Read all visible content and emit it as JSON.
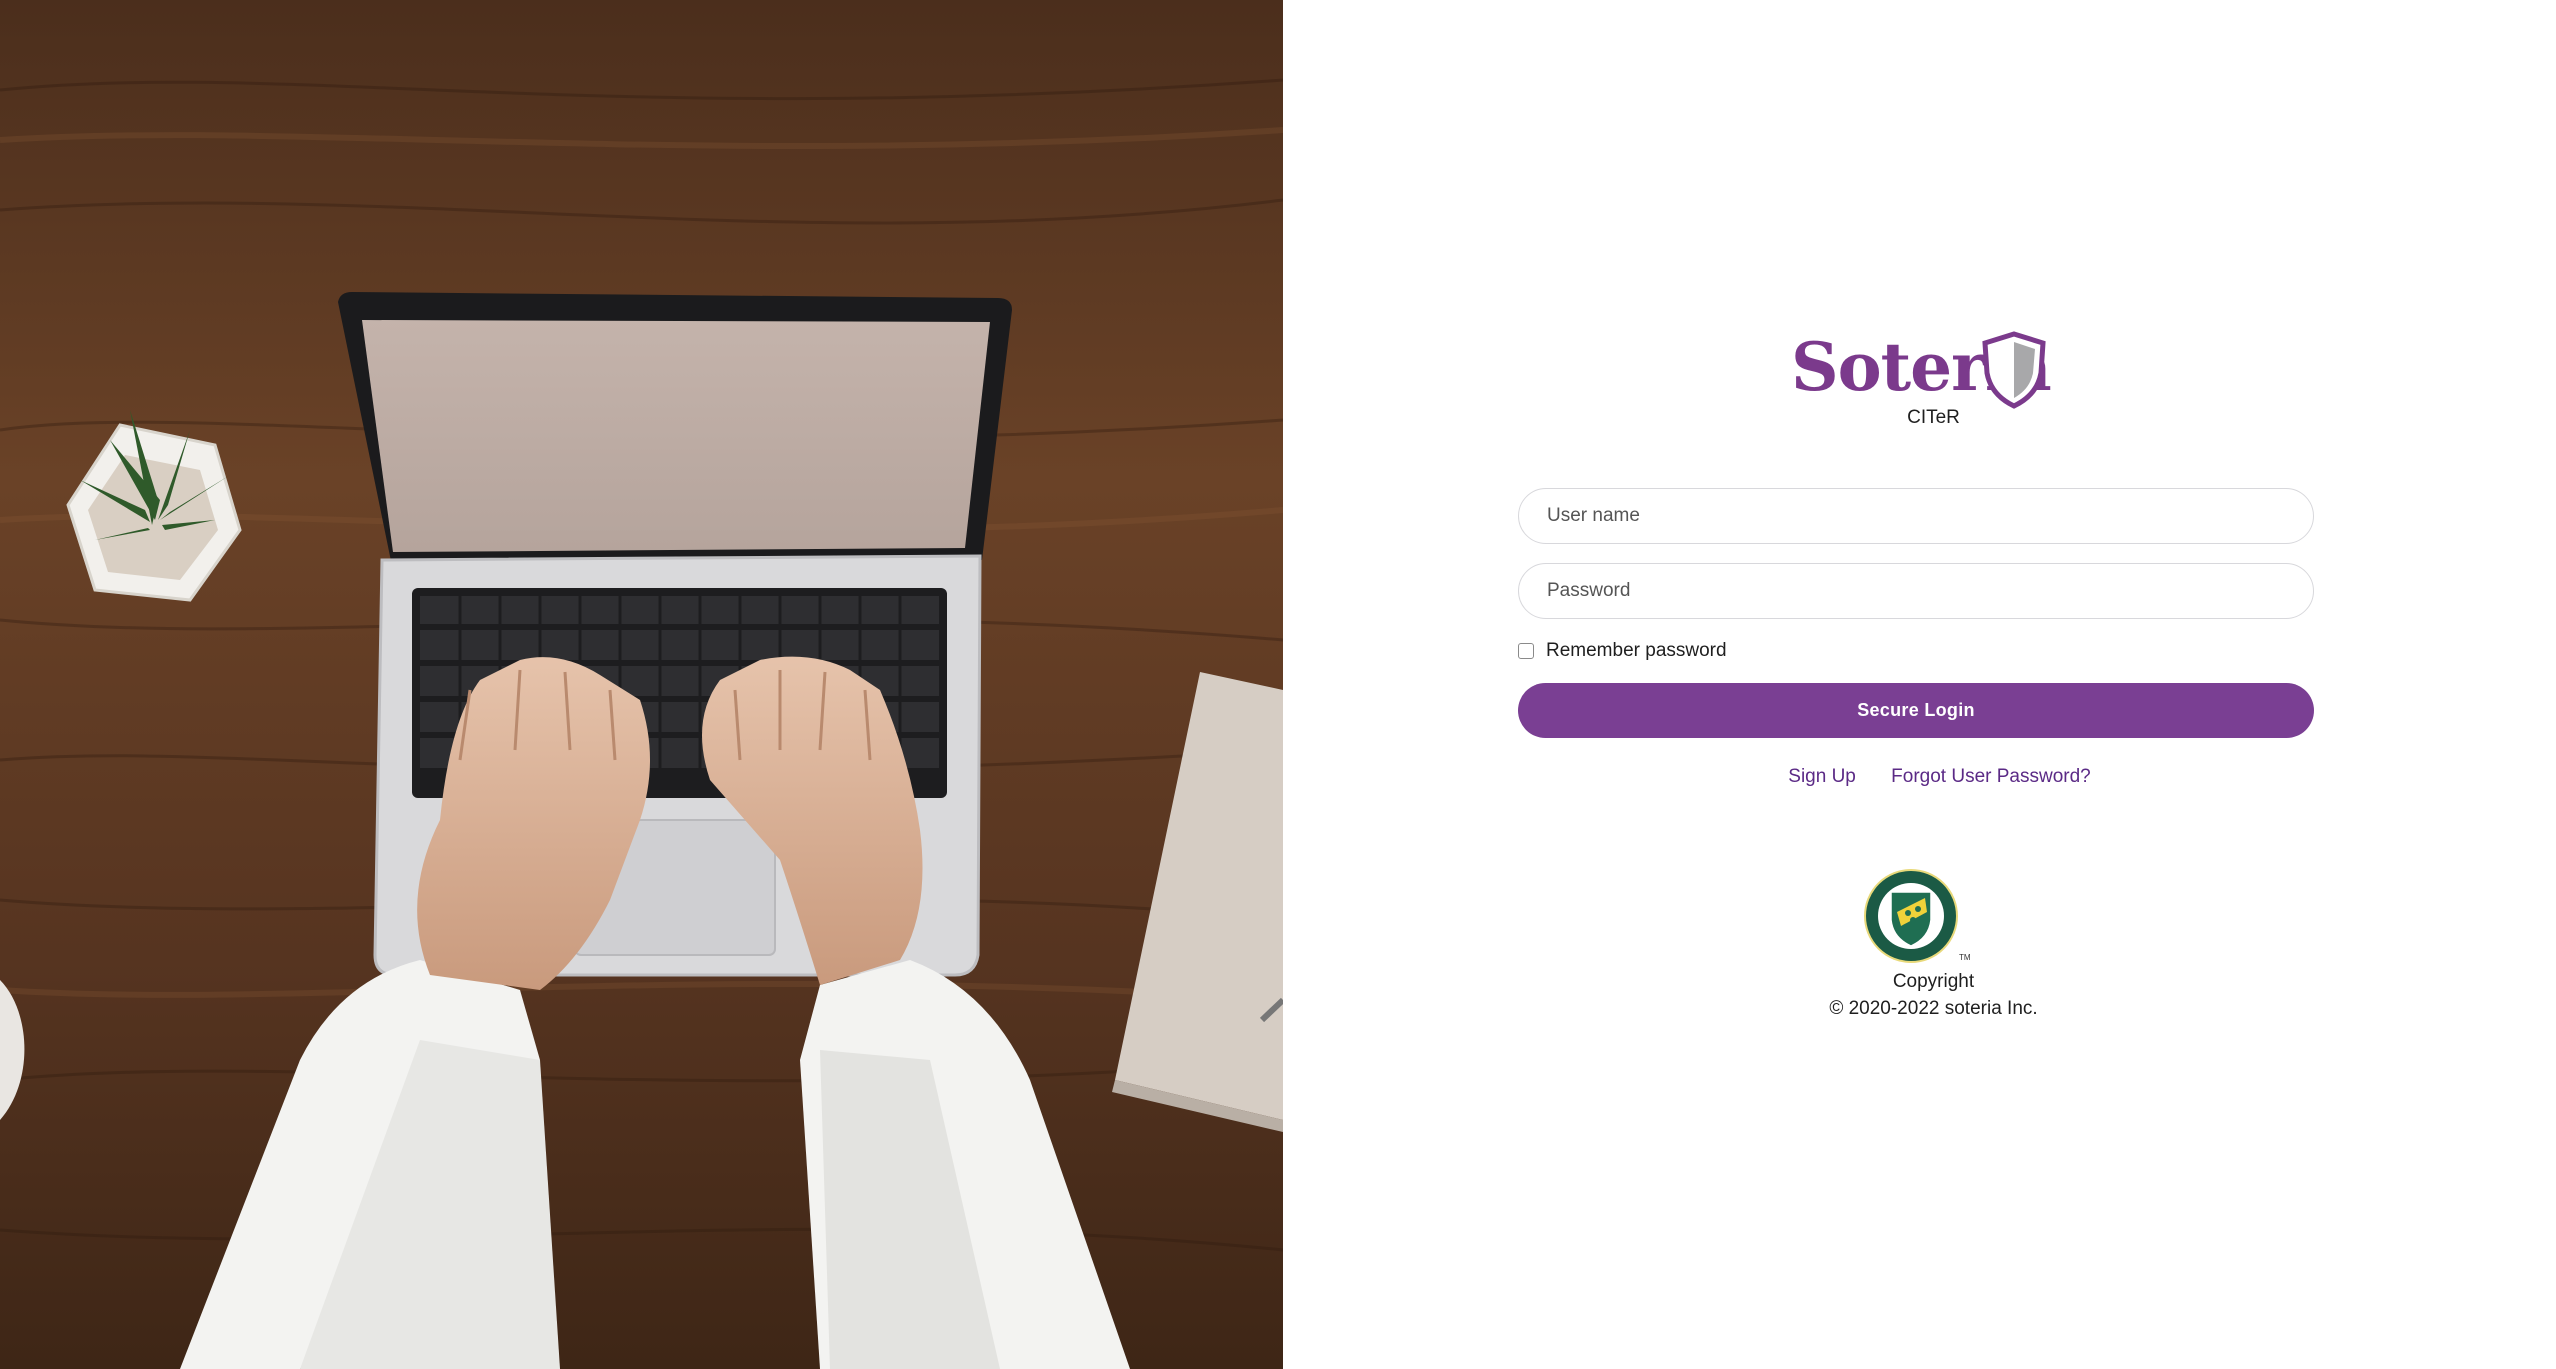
{
  "brand": {
    "name": "Soteria",
    "org": "CITeR",
    "color": "#7b3a8c"
  },
  "login_form": {
    "username_placeholder": "User name",
    "password_placeholder": "Password",
    "remember_label": "Remember password",
    "remember_checked": false,
    "submit_label": "Secure Login",
    "button_color": "#7a3f93"
  },
  "links": {
    "signup": "Sign Up",
    "forgot": "Forgot User Password?"
  },
  "footer": {
    "seal_name": "clarkson-university-seal",
    "seal_text": "CLARKSON UNIVERSITY · TECHNOLOGY ·",
    "copyright_title": "Copyright",
    "copyright_text": "© 2020-2022 soteria Inc."
  }
}
